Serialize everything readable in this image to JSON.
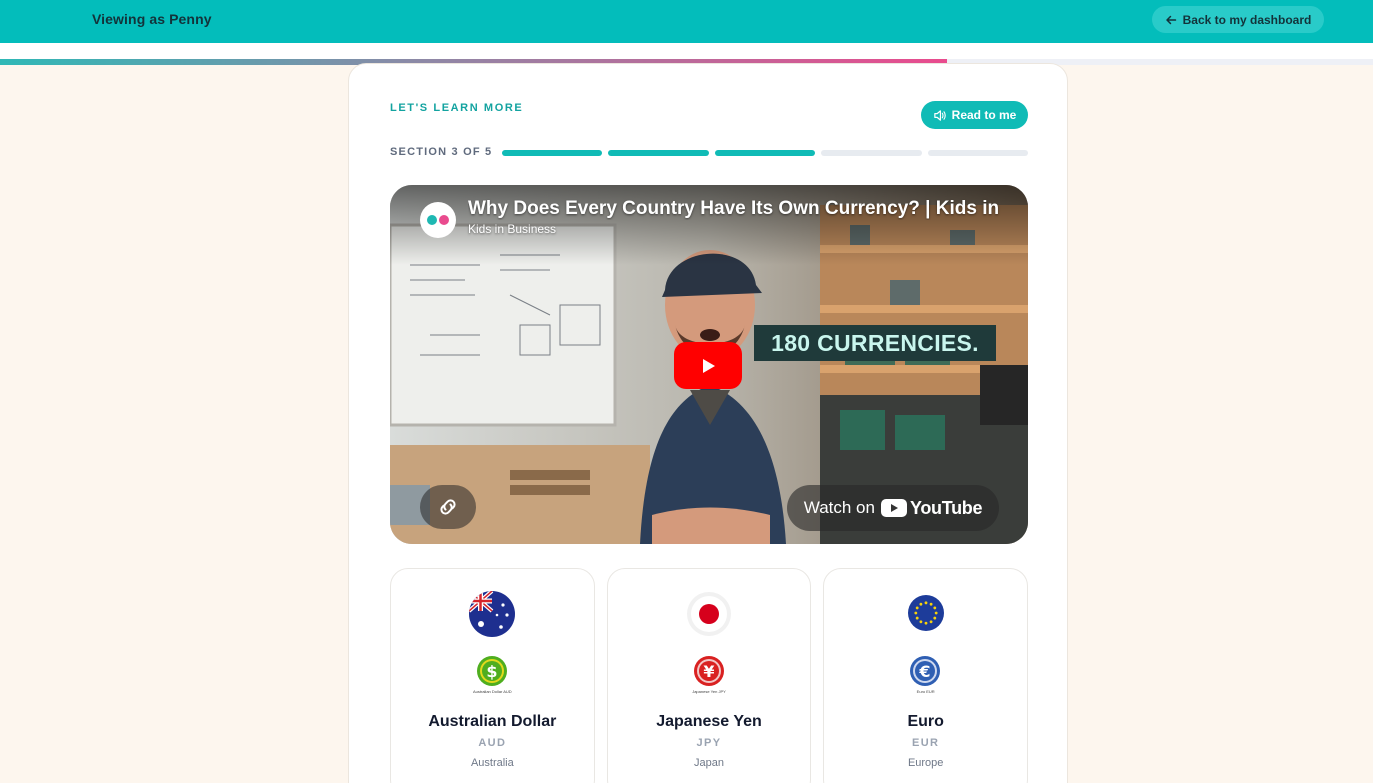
{
  "header": {
    "viewing_as": "Viewing as Penny",
    "back_label": "Back to my dashboard"
  },
  "lesson_progress": {
    "fraction": 0.69
  },
  "lesson": {
    "eyebrow": "LET'S LEARN MORE",
    "read_label": "Read to me",
    "section_label": "SECTION 3 OF 5",
    "section_current": 3,
    "section_total": 5
  },
  "video": {
    "title": "Why Does Every Country Have Its Own Currency? | Kids in",
    "channel": "Kids in Business",
    "banner_text": "180 CURRENCIES.",
    "watch_on": "Watch on",
    "platform": "YouTube"
  },
  "currencies": [
    {
      "name": "Australian Dollar",
      "code": "AUD",
      "region": "Australia",
      "symbol": "$",
      "coin_caption": "Australian Dollar AUD",
      "coin_color": "#4fae1f",
      "flag": "australia"
    },
    {
      "name": "Japanese Yen",
      "code": "JPY",
      "region": "Japan",
      "symbol": "¥",
      "coin_caption": "Japanese Yen JPY",
      "coin_color": "#d92121",
      "flag": "japan"
    },
    {
      "name": "Euro",
      "code": "EUR",
      "region": "Europe",
      "symbol": "€",
      "coin_caption": "Euro EUR",
      "coin_color": "#2f5fb3",
      "flag": "eu"
    }
  ],
  "colors": {
    "brand_teal": "#03bdbb",
    "accent_teal": "#10bbb6",
    "page_bg": "#fdf6ee",
    "progress_pink": "#e94b8e"
  },
  "icons": [
    "arrow-left-icon",
    "speaker-icon",
    "play-icon",
    "link-icon",
    "youtube-logo-icon"
  ]
}
